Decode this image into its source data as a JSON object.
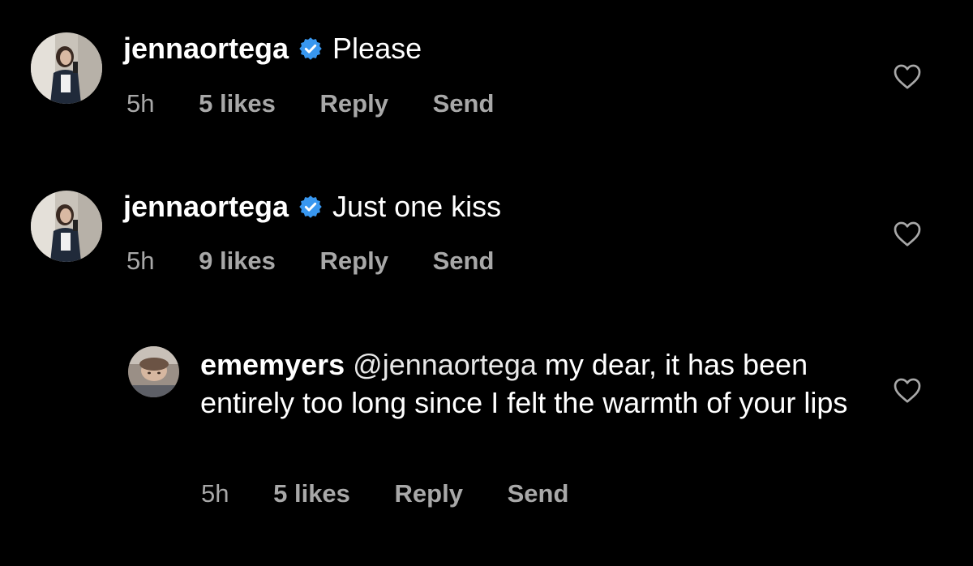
{
  "comments": [
    {
      "username": "jennaortega",
      "verified": true,
      "text": "Please",
      "time": "5h",
      "likes": "5 likes",
      "reply_label": "Reply",
      "send_label": "Send"
    },
    {
      "username": "jennaortega",
      "verified": true,
      "text": "Just one kiss",
      "time": "5h",
      "likes": "9 likes",
      "reply_label": "Reply",
      "send_label": "Send"
    },
    {
      "username": "ememyers",
      "verified": false,
      "mention": "@jennaortega",
      "text": "my dear, it has been entirely too long since I felt the warmth of your lips",
      "time": "5h",
      "likes": "5 likes",
      "reply_label": "Reply",
      "send_label": "Send"
    }
  ],
  "colors": {
    "background": "#000000",
    "text": "#ffffff",
    "meta": "#a8a8a8",
    "verified_badge": "#3897f0"
  },
  "icons": {
    "like": "heart-outline-icon",
    "verified": "verified-badge-icon"
  }
}
